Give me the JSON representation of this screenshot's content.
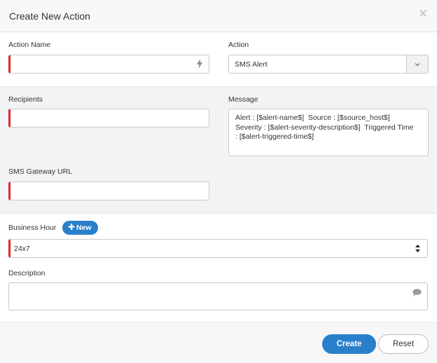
{
  "dialog": {
    "title": "Create New Action",
    "close_icon": "close-icon"
  },
  "form": {
    "action_name": {
      "label": "Action Name",
      "value": "",
      "icon": "bolt-icon"
    },
    "action": {
      "label": "Action",
      "selected": "SMS Alert",
      "icon": "chevron-down-icon"
    },
    "recipients": {
      "label": "Recipients",
      "value": ""
    },
    "message": {
      "label": "Message",
      "value": "Alert : [$alert-name$]  Source : [$source_host$]\nSeverity : [$alert-severity-description$]  Triggered Time\n: [$alert-triggered-time$]"
    },
    "sms_gateway_url": {
      "label": "SMS Gateway URL",
      "value": ""
    },
    "business_hour": {
      "label": "Business Hour",
      "new_button": "New",
      "new_icon": "plus-icon",
      "selected": "24x7",
      "icon": "updown-icon"
    },
    "description": {
      "label": "Description",
      "value": "",
      "icon": "comment-icon"
    }
  },
  "footer": {
    "create_label": "Create",
    "reset_label": "Reset"
  },
  "colors": {
    "accent": "#2a7fcb",
    "required": "#e0262d",
    "section_bg": "#f2f3f5"
  }
}
